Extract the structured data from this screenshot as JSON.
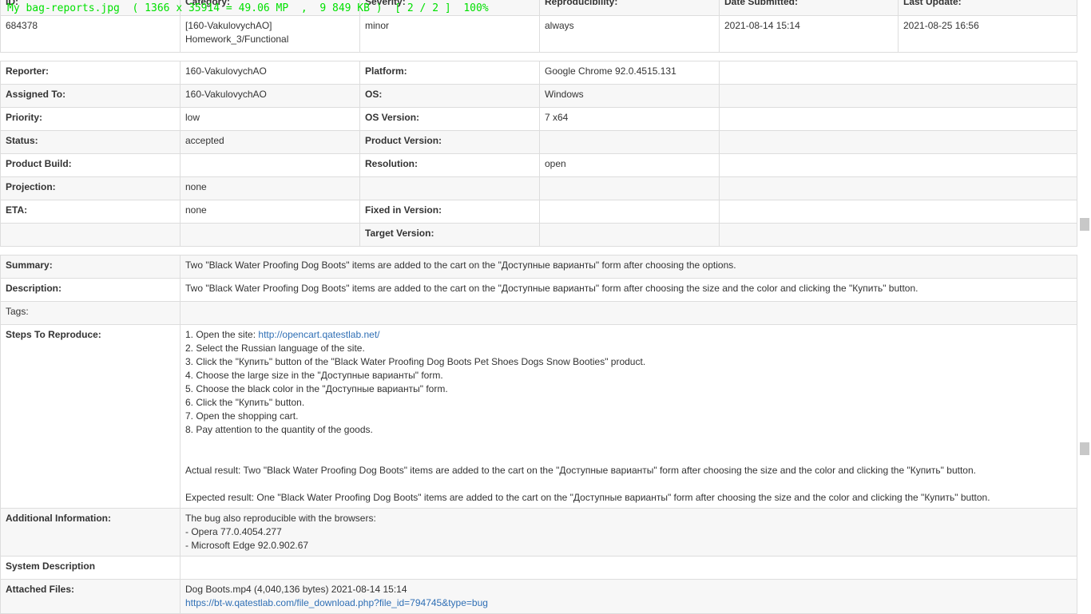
{
  "viewer": {
    "overlay_text": "My bag-reports.jpg  ( 1366 x 35914 = 49.06 MP  ,  9 849 KB )  [ 2 / 2 ]  100%"
  },
  "header_labels": {
    "id": "ID:",
    "category": "Category:",
    "severity": "Severity:",
    "reproducibility": "Reproducibility:",
    "date_submitted": "Date Submitted:",
    "last_update": "Last Update:"
  },
  "header_values": {
    "id": "684378",
    "category_line1": "[160-VakulovychAO]",
    "category_line2": "Homework_3/Functional",
    "severity": "minor",
    "reproducibility": "always",
    "date_submitted": "2021-08-14 15:14",
    "last_update": "2021-08-25 16:56"
  },
  "details": {
    "reporter_label": "Reporter:",
    "reporter_value": "160-VakulovychAO",
    "platform_label": "Platform:",
    "platform_value": "Google Chrome 92.0.4515.131",
    "assigned_label": "Assigned To:",
    "assigned_value": "160-VakulovychAO",
    "os_label": "OS:",
    "os_value": "Windows",
    "priority_label": "Priority:",
    "priority_value": "low",
    "os_version_label": "OS Version:",
    "os_version_value": "7 x64",
    "status_label": "Status:",
    "status_value": "accepted",
    "product_version_label": "Product Version:",
    "product_build_label": "Product Build:",
    "resolution_label": "Resolution:",
    "resolution_value": "open",
    "projection_label": "Projection:",
    "projection_value": "none",
    "eta_label": "ETA:",
    "eta_value": "none",
    "fixed_in_label": "Fixed in Version:",
    "target_version_label": "Target Version:"
  },
  "summary": {
    "label": "Summary:",
    "value": "Two \"Black Water Proofing Dog Boots\" items are added to the cart on the \"Доступные варианты\" form after choosing the options."
  },
  "description": {
    "label": "Description:",
    "value": "Two \"Black Water Proofing Dog Boots\" items are added to the cart on the \"Доступные варианты\" form after choosing the size and the color and clicking the \"Купить\" button."
  },
  "tags": {
    "label": "Tags:"
  },
  "steps": {
    "label": "Steps To Reproduce:",
    "step1_prefix": "1. Open the site: ",
    "step1_link": "http://opencart.qatestlab.net/",
    "step2": "2. Select the Russian language of the site.",
    "step3": "3. Click the \"Купить\" button of the \"Black Water Proofing Dog Boots Pet Shoes Dogs Snow Booties\" product.",
    "step4": "4. Choose the large size in the \"Доступные варианты\" form.",
    "step5": "5. Choose the black color in the \"Доступные варианты\" form.",
    "step6": "6. Click the \"Купить\" button.",
    "step7": "7. Open the shopping cart.",
    "step8": "8. Pay attention to the quantity of the goods.",
    "actual": "Actual result: Two \"Black Water Proofing Dog Boots\" items are added to the cart on the \"Доступные варианты\" form after choosing the size and the color and clicking the \"Купить\" button.",
    "expected": "Expected result: One \"Black Water Proofing Dog Boots\" items are added to the cart on the \"Доступные варианты\" form after choosing the size and the color and clicking the \"Купить\" button."
  },
  "additional": {
    "label": "Additional Information:",
    "line1": "The bug also reproducible with the browsers:",
    "line2": "- Opera 77.0.4054.277",
    "line3": "- Microsoft Edge 92.0.902.67"
  },
  "system_description": {
    "label": "System Description"
  },
  "attached": {
    "label": "Attached Files:",
    "file_line": "Dog Boots.mp4 (4,040,136 bytes) 2021-08-14 15:14",
    "file_link": "https://bt-w.qatestlab.com/file_download.php?file_id=794745&type=bug"
  }
}
